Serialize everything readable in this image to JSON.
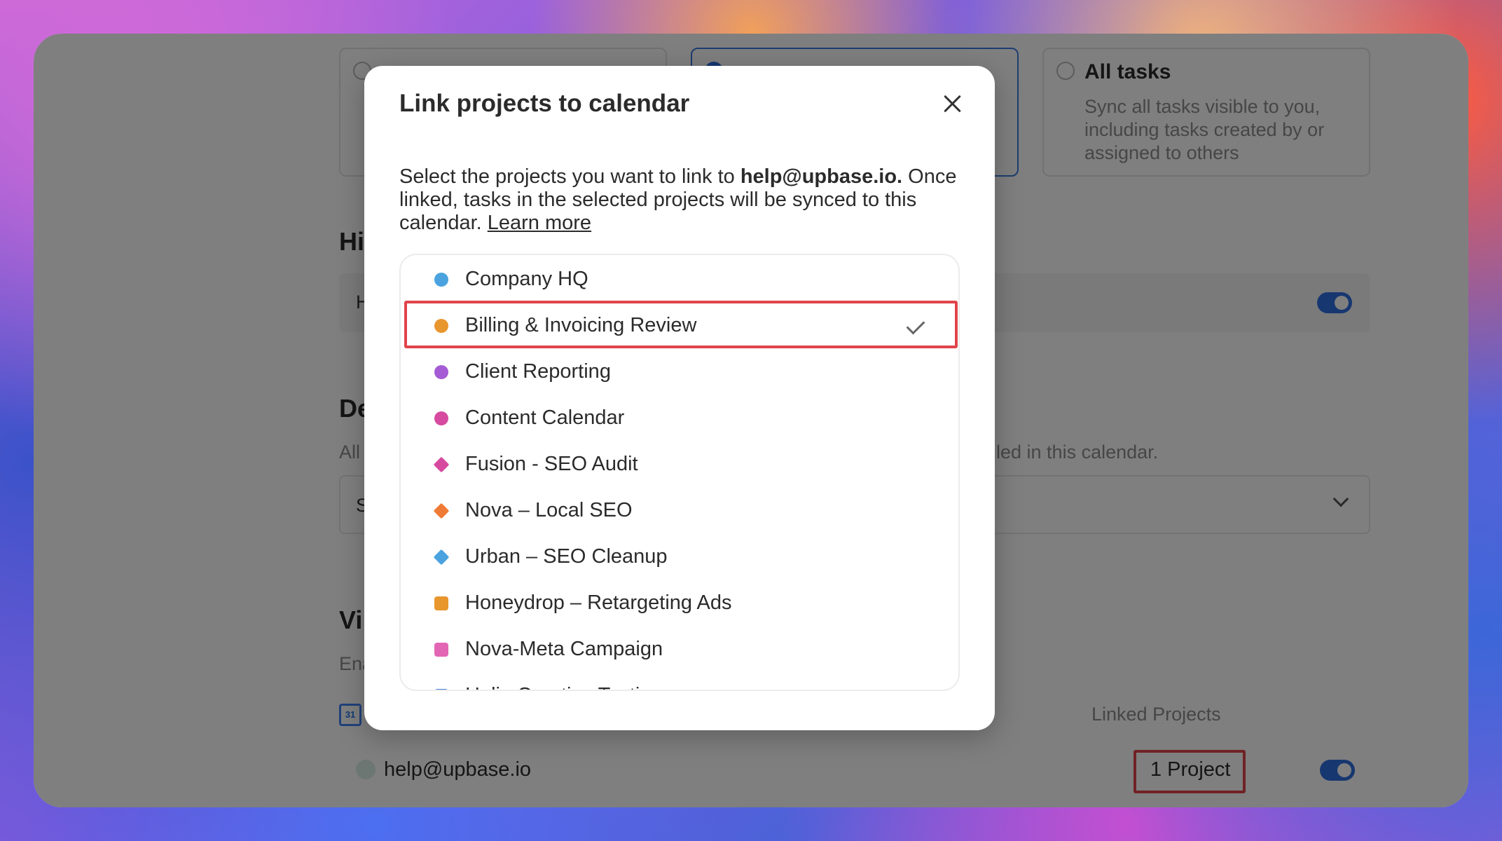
{
  "sync_options": [
    {
      "title": "",
      "description": "",
      "selected": false
    },
    {
      "title": "",
      "description": "",
      "selected": true
    },
    {
      "title": "All tasks",
      "description": "Sync all tasks visible to you, including tasks created by or assigned to others",
      "selected": false
    }
  ],
  "background_sections": {
    "hide_heading": "Hi",
    "hide_row_text": "H",
    "default_heading": "De",
    "default_sub_left": "All",
    "default_sub_right": "led in this calendar.",
    "default_select_value": "S",
    "visibility_heading": "Vi",
    "visibility_sub": "Ena",
    "calendar_icon_text": "31",
    "linked_projects_header": "Linked Projects",
    "account_email": "help@upbase.io",
    "linked_count": "1 Project"
  },
  "modal": {
    "title": "Link projects to calendar",
    "desc_prefix": "Select the projects you want to link to ",
    "desc_email": "help@upbase.io.",
    "desc_suffix": " Once linked, tasks in the selected projects will be synced to this calendar. ",
    "learn_more": "Learn more"
  },
  "projects": [
    {
      "name": "Company HQ",
      "color": "#4aa3df",
      "shape": "circle",
      "checked": false
    },
    {
      "name": "Billing & Invoicing Review",
      "color": "#e8962e",
      "shape": "circle",
      "checked": true
    },
    {
      "name": "Client Reporting",
      "color": "#a55bd4",
      "shape": "circle",
      "checked": false
    },
    {
      "name": "Content Calendar",
      "color": "#d64aa0",
      "shape": "circle",
      "checked": false
    },
    {
      "name": "Fusion - SEO Audit",
      "color": "#d64aa0",
      "shape": "diamond",
      "checked": false
    },
    {
      "name": "Nova – Local SEO",
      "color": "#ef7a35",
      "shape": "diamond",
      "checked": false
    },
    {
      "name": "Urban – SEO Cleanup",
      "color": "#4aa3df",
      "shape": "diamond",
      "checked": false
    },
    {
      "name": "Honeydrop – Retargeting Ads",
      "color": "#e8962e",
      "shape": "square",
      "checked": false
    },
    {
      "name": "Nova-Meta Campaign",
      "color": "#e266b4",
      "shape": "square",
      "checked": false
    },
    {
      "name": "Holio Creative Testing",
      "color": "#4a7fd4",
      "shape": "square",
      "checked": false
    }
  ],
  "colors": {
    "accent": "#2f6fe0",
    "highlight": "#e0444b"
  }
}
